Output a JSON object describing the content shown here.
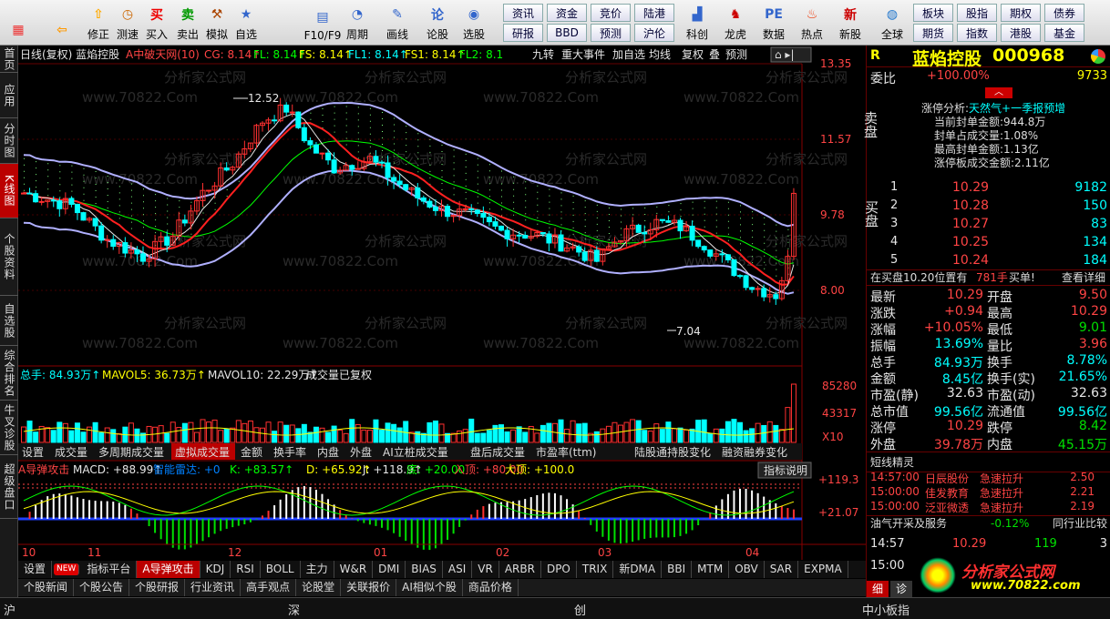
{
  "toolbar": {
    "buttons": [
      {
        "label": "",
        "icon": "grid-app-icon"
      },
      {
        "label": "",
        "icon": "back-arrow-icon"
      },
      {
        "label": "修正",
        "icon": "arrow-up-icon"
      },
      {
        "label": "测速",
        "icon": "clock-icon"
      },
      {
        "label": "买入",
        "icon": "buy-icon"
      },
      {
        "label": "卖出",
        "icon": "sell-icon"
      },
      {
        "label": "模拟",
        "icon": "hammer-icon"
      },
      {
        "label": "自选",
        "icon": "star-icon"
      },
      {
        "label": "F10/F9",
        "icon": "f10-icon"
      },
      {
        "label": "周期",
        "icon": "period-icon"
      },
      {
        "label": "画线",
        "icon": "pencil-icon"
      },
      {
        "label": "论股",
        "icon": "discuss-icon"
      },
      {
        "label": "选股",
        "icon": "select-icon"
      }
    ],
    "small_buttons": [
      "资讯",
      "资金",
      "竞价",
      "陆港",
      "研报",
      "BBD",
      "预测",
      "沪伦"
    ],
    "right_buttons": [
      {
        "label": "科创",
        "icon": "chart-icon"
      },
      {
        "label": "龙虎",
        "icon": "tiger-icon"
      },
      {
        "label": "数据",
        "icon": "pe-icon"
      },
      {
        "label": "热点",
        "icon": "fire-icon"
      },
      {
        "label": "新股",
        "icon": "new-stock-icon"
      },
      {
        "label": "全球",
        "icon": "globe-icon"
      }
    ],
    "far_right": [
      "板块",
      "股指",
      "期权",
      "债券",
      "期货",
      "指数",
      "港股",
      "基金"
    ]
  },
  "left_tabs": [
    "首页",
    "应用",
    "分时图",
    "K线图",
    "个股资料",
    "自选股",
    "综合排名",
    "牛叉诊股",
    "超级盘口"
  ],
  "chart": {
    "header": "日线(复权)  蓝焰控股",
    "indicator": "A中破天网(10)",
    "ind_values": [
      {
        "t": "CG: 8.14↑",
        "c": "#ff4444"
      },
      {
        "t": "FL: 8.14↑",
        "c": "#00ff00"
      },
      {
        "t": "FS: 8.14↑",
        "c": "#ffff00"
      },
      {
        "t": "FL1: 8.14↑",
        "c": "#00ffff"
      },
      {
        "t": "FS1: 8.14↑",
        "c": "#ffff00"
      },
      {
        "t": "FL2: 8.1",
        "c": "#00ff00"
      }
    ],
    "right_tools": [
      "九转",
      "重大事件",
      "加自选",
      "均线",
      "复权",
      "叠",
      "预测"
    ],
    "price_ticks": [
      "13.35",
      "11.57",
      "9.78",
      "8.00"
    ],
    "high_label": "12.52",
    "low_label": "7.04",
    "watermark": "www.70822.Com",
    "watermark2": "分析家公式网",
    "vol_header": [
      {
        "t": "总手: 84.93万↑",
        "c": "#00ffff"
      },
      {
        "t": "MAVOL5: 36.73万↑",
        "c": "#ffff00"
      },
      {
        "t": "MAVOL10: 22.29万↑",
        "c": "#e6e6e6"
      },
      {
        "t": "成交量已复权",
        "c": "#e6e6e6"
      }
    ],
    "vol_ticks": [
      "85280",
      "43317",
      "X10"
    ],
    "vol_tabs": [
      "设置",
      "成交量",
      "多周期成交量",
      "虚拟成交量",
      "金额",
      "换手率",
      "内盘",
      "外盘",
      "AI立桩成交量",
      "盘后成交量",
      "市盈率(ttm)",
      "陆股通持股变化",
      "融资融券变化"
    ],
    "macd_header": [
      {
        "t": "A导弹攻击",
        "c": "#ff4444"
      },
      {
        "t": "MACD: +88.99↑",
        "c": "#e6e6e6"
      },
      {
        "t": "智能雷达: +0",
        "c": "#0080ff"
      },
      {
        "t": "K: +83.57↑",
        "c": "#00ff00"
      },
      {
        "t": "D: +65.92↑",
        "c": "#ffff00"
      },
      {
        "t": "J: +118.9↑",
        "c": "#e6e6e6"
      },
      {
        "t": "底: +20.00",
        "c": "#00ff00"
      },
      {
        "t": "入顶: +80.00",
        "c": "#ff4444"
      },
      {
        "t": "大顶: +100.0",
        "c": "#ffff00"
      }
    ],
    "macd_button": "指标说明",
    "macd_ticks": [
      "+119.3",
      "+21.07"
    ],
    "x_ticks": [
      "10",
      "11",
      "12",
      "01",
      "02",
      "03",
      "04"
    ]
  },
  "bottom_tabs": [
    "设置",
    "NEW",
    "指标平台",
    "A导弹攻击",
    "KDJ",
    "RSI",
    "BOLL",
    "主力",
    "W&R",
    "DMI",
    "BIAS",
    "ASI",
    "VR",
    "ARBR",
    "DPO",
    "TRIX",
    "新DMA",
    "BBI",
    "MTM",
    "OBV",
    "SAR",
    "EXPMA"
  ],
  "news_tabs": [
    "个股新闻",
    "个股公告",
    "个股研报",
    "行业资讯",
    "高手观点",
    "论股堂",
    "关联报价",
    "AI相似个股",
    "商品价格"
  ],
  "quote": {
    "name": "蓝焰控股",
    "code": "000968",
    "r": "R",
    "weibi_label": "委比",
    "weibi": "+100.00%",
    "weibi_vol": "9733",
    "sell_label": "卖盘",
    "limit_title": "涨停分析:",
    "limit_reason": "天然气+一季报预增",
    "limit_lines": [
      "当前封单金额:944.8万",
      "封单占成交量:1.08%",
      "最高封单金额:1.13亿",
      "涨停板成交金额:2.11亿"
    ],
    "buy_label": "买盘",
    "bids": [
      {
        "n": "1",
        "p": "10.29",
        "v": "9182"
      },
      {
        "n": "2",
        "p": "10.28",
        "v": "150"
      },
      {
        "n": "3",
        "p": "10.27",
        "v": "83"
      },
      {
        "n": "4",
        "p": "10.25",
        "v": "134"
      },
      {
        "n": "5",
        "p": "10.24",
        "v": "184"
      }
    ],
    "bid_note": "在买盘10.20位置有",
    "bid_note_vol": "781手",
    "bid_note_tail": "买单!",
    "detail": "查看详细",
    "stats": [
      {
        "l": "最新",
        "v": "10.29",
        "vc": "r",
        "l2": "开盘",
        "v2": "9.50",
        "v2c": "r"
      },
      {
        "l": "涨跌",
        "v": "+0.94",
        "vc": "r",
        "l2": "最高",
        "v2": "10.29",
        "v2c": "r"
      },
      {
        "l": "涨幅",
        "v": "+10.05%",
        "vc": "r",
        "l2": "最低",
        "v2": "9.01",
        "v2c": "g"
      },
      {
        "l": "振幅",
        "v": "13.69%",
        "vc": "c",
        "l2": "量比",
        "v2": "3.96",
        "v2c": "r"
      },
      {
        "l": "总手",
        "v": "84.93万",
        "vc": "c",
        "l2": "换手",
        "v2": "8.78%",
        "v2c": "c"
      },
      {
        "l": "金额",
        "v": "8.45亿",
        "vc": "c",
        "l2": "换手(实)",
        "v2": "21.65%",
        "v2c": "c"
      },
      {
        "l": "市盈(静)",
        "v": "32.63",
        "vc": "w",
        "l2": "市盈(动)",
        "v2": "32.63",
        "v2c": "w"
      },
      {
        "l": "总市值",
        "v": "99.56亿",
        "vc": "c",
        "l2": "流通值",
        "v2": "99.56亿",
        "v2c": "c"
      },
      {
        "l": "涨停",
        "v": "10.29",
        "vc": "r",
        "l2": "跌停",
        "v2": "8.42",
        "v2c": "g"
      },
      {
        "l": "外盘",
        "v": "39.78万",
        "vc": "r",
        "l2": "内盘",
        "v2": "45.15万",
        "v2c": "g"
      }
    ],
    "short_title": "短线精灵",
    "short_rows": [
      {
        "t": "14:57:00",
        "n": "日辰股份",
        "a": "急速拉升",
        "p": "2.50"
      },
      {
        "t": "15:00:00",
        "n": "佳发教育",
        "a": "急速拉升",
        "p": "2.21"
      },
      {
        "t": "15:00:00",
        "n": "泛亚微透",
        "a": "急速拉升",
        "p": "2.19"
      }
    ],
    "industry": "油气开采及服务",
    "industry_pct": "-0.12%",
    "industry_btn": "同行业比较",
    "ticks": [
      {
        "t": "14:57",
        "p": "10.29",
        "v": "119",
        "f": "3"
      },
      {
        "t": "15:00",
        "p": "",
        "v": "",
        "f": ""
      }
    ],
    "bottom_tabs": [
      "细",
      "诊"
    ],
    "logo_text": "分析家公式网",
    "logo_url": "www.70822.com"
  },
  "status": {
    "items": [
      "沪",
      "深",
      "创",
      "中小板指"
    ]
  }
}
